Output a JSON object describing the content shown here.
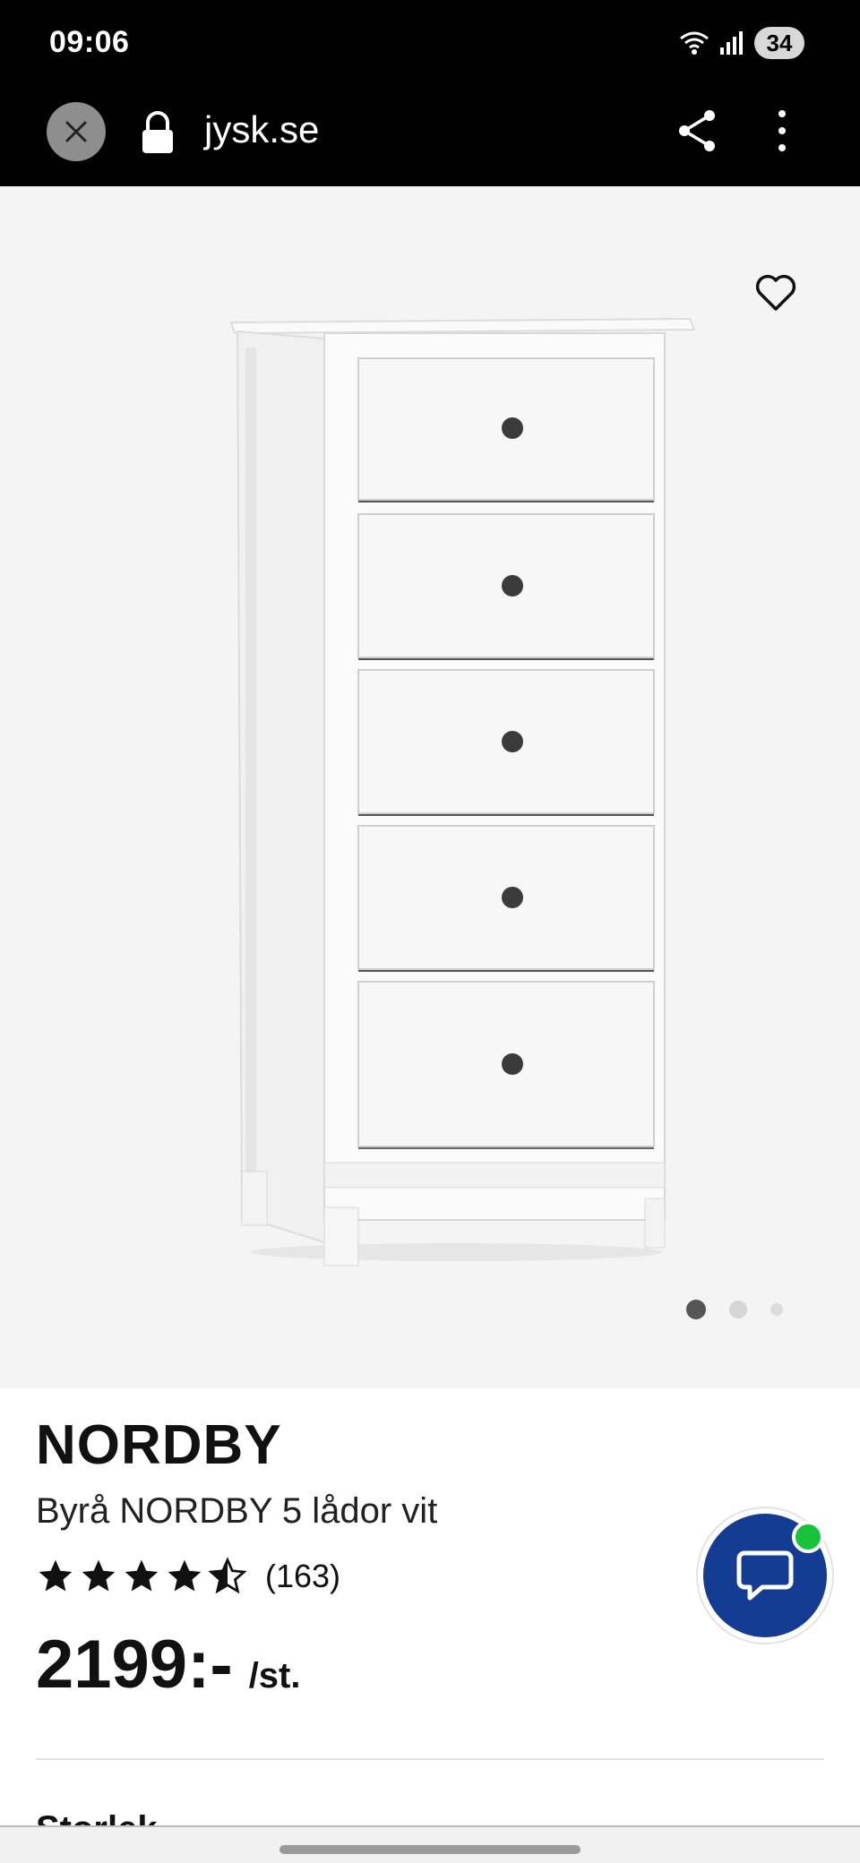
{
  "status_bar": {
    "time": "09:06",
    "battery": "34",
    "icons": [
      "wifi-icon",
      "signal-icon",
      "battery-icon"
    ]
  },
  "browser": {
    "url": "jysk.se",
    "icons": [
      "close-icon",
      "lock-icon",
      "share-icon",
      "more-vertical-icon"
    ]
  },
  "gallery": {
    "image_alt": "Byrå NORDBY 5 lådor vit",
    "drawers": 5,
    "current_slide": 1,
    "slide_count": 3
  },
  "product": {
    "title": "NORDBY",
    "subtitle": "Byrå NORDBY 5 lådor vit",
    "rating": 4.5,
    "rating_count": "(163)",
    "price": "2199:-",
    "unit": "/st."
  },
  "next_section": {
    "heading": "Storlek"
  },
  "colors": {
    "chat_button": "#153c93",
    "chat_online": "#19c23b",
    "gallery_bg": "#f4f4f4"
  }
}
